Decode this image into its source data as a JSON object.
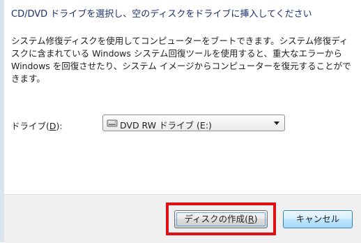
{
  "dialog": {
    "header": "CD/DVD ドライブを選択し、空のディスクをドライブに挿入してください",
    "description": "システム修復ディスクを使用してコンピューターをブートできます。システム修復ディスクに含まれている Windows システム回復ツールを使用すると、重大なエラーから Windows を回復させたり、システム イメージからコンピューターを復元することができます。"
  },
  "drive": {
    "label_prefix": "ドライブ(",
    "label_accel": "D",
    "label_suffix": "):",
    "selected": "DVD RW ドライブ (E:)"
  },
  "buttons": {
    "create_prefix": "ディスクの作成(",
    "create_accel": "R",
    "create_suffix": ")",
    "cancel": "キャンセル"
  },
  "colors": {
    "header_text": "#1a3070",
    "highlight_border": "#e01010",
    "cancel_button_focus": "#a7d9f5"
  },
  "icons": {
    "drive": "optical-drive-icon",
    "dropdown": "chevron-down-icon"
  }
}
